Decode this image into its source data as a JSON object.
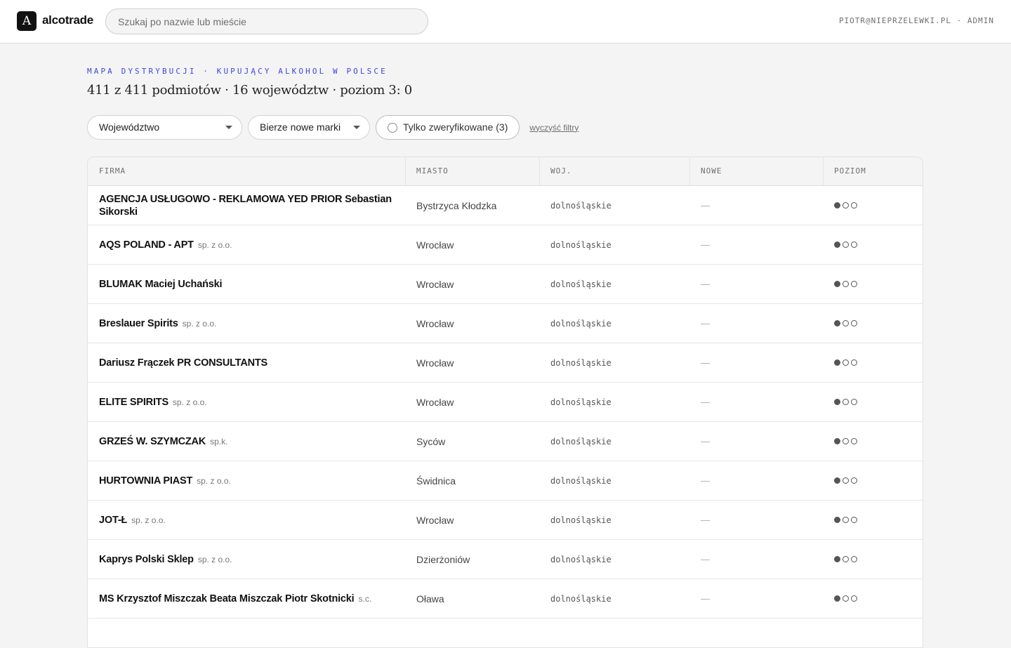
{
  "header": {
    "logo_letter": "A",
    "logo_text": "alcotrade",
    "search_placeholder": "Szukaj po nazwie lub mieście",
    "user": "PIOTR@NIEPRZELEWKI.PL · ADMIN"
  },
  "page": {
    "kicker": "MAPA DYSTRYBUCJI · KUPUJĄCY ALKOHOL W POLSCE",
    "headline": "411 z 411 podmiotów · 16 województw · poziom 3: 0"
  },
  "filters": {
    "region": "Województwo",
    "new_brands": "Bierze nowe marki",
    "verified": "Tylko zweryfikowane (3)",
    "clear": "wyczyść filtry"
  },
  "table": {
    "columns": {
      "firma": "FIRMA",
      "miasto": "MIASTO",
      "woj": "WOJ.",
      "nowe": "NOWE",
      "poziom": "POZIOM"
    },
    "rows": [
      {
        "name": "AGENCJA USŁUGOWO - REKLAMOWA YED PRIOR Sebastian Sikorski",
        "type": "",
        "city": "Bystrzyca Kłodzka",
        "region": "dolnośląskie",
        "nowe": "—",
        "level": 1
      },
      {
        "name": "AQS POLAND - APT",
        "type": "sp. z o.o.",
        "city": "Wrocław",
        "region": "dolnośląskie",
        "nowe": "—",
        "level": 1
      },
      {
        "name": "BLUMAK Maciej Uchański",
        "type": "",
        "city": "Wrocław",
        "region": "dolnośląskie",
        "nowe": "—",
        "level": 1
      },
      {
        "name": "Breslauer Spirits",
        "type": "sp. z o.o.",
        "city": "Wrocław",
        "region": "dolnośląskie",
        "nowe": "—",
        "level": 1
      },
      {
        "name": "Dariusz Frączek PR CONSULTANTS",
        "type": "",
        "city": "Wrocław",
        "region": "dolnośląskie",
        "nowe": "—",
        "level": 1
      },
      {
        "name": "ELITE SPIRITS",
        "type": "sp. z o.o.",
        "city": "Wrocław",
        "region": "dolnośląskie",
        "nowe": "—",
        "level": 1
      },
      {
        "name": "GRZEŚ W. SZYMCZAK",
        "type": "sp.k.",
        "city": "Syców",
        "region": "dolnośląskie",
        "nowe": "—",
        "level": 1
      },
      {
        "name": "HURTOWNIA PIAST",
        "type": "sp. z o.o.",
        "city": "Świdnica",
        "region": "dolnośląskie",
        "nowe": "—",
        "level": 1
      },
      {
        "name": "JOT-Ł",
        "type": "sp. z o.o.",
        "city": "Wrocław",
        "region": "dolnośląskie",
        "nowe": "—",
        "level": 1
      },
      {
        "name": "Kaprys Polski Sklep",
        "type": "sp. z o.o.",
        "city": "Dzierżoniów",
        "region": "dolnośląskie",
        "nowe": "—",
        "level": 1
      },
      {
        "name": "MS Krzysztof Miszczak Beata Miszczak Piotr Skotnicki",
        "type": "s.c.",
        "city": "Oława",
        "region": "dolnośląskie",
        "nowe": "—",
        "level": 1
      }
    ]
  }
}
